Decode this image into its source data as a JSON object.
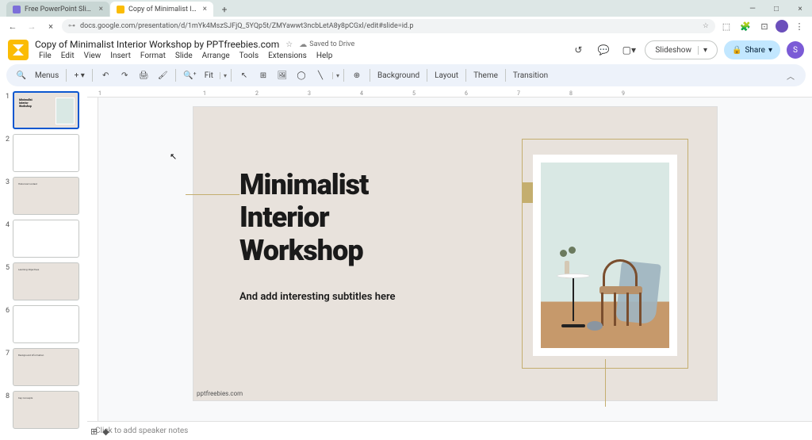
{
  "browser": {
    "tabs": [
      {
        "title": "Free PowerPoint Slide Downl",
        "active": false
      },
      {
        "title": "Copy of Minimalist Interior Wo",
        "active": true
      }
    ],
    "url": "docs.google.com/presentation/d/1mYk4MszSJFjQ_5YQp5t/ZMYawwt3ncbLetA8y8pCGxl/edit#slide=id.p"
  },
  "header": {
    "doc_title": "Copy of Minimalist Interior Workshop by PPTfreebies.com",
    "saved_status": "Saved to Drive",
    "menu": [
      "File",
      "Edit",
      "View",
      "Insert",
      "Format",
      "Slide",
      "Arrange",
      "Tools",
      "Extensions",
      "Help"
    ],
    "slideshow": "Slideshow",
    "share": "Share",
    "avatar_letter": "S"
  },
  "toolbar": {
    "menus": "Menus",
    "zoom": "Fit",
    "background": "Background",
    "layout": "Layout",
    "theme": "Theme",
    "transition": "Transition"
  },
  "filmstrip": {
    "slides": [
      {
        "n": "1",
        "kind": "title"
      },
      {
        "n": "2",
        "kind": "blank"
      },
      {
        "n": "3",
        "kind": "context",
        "label": "Historical Context"
      },
      {
        "n": "4",
        "kind": "blank"
      },
      {
        "n": "5",
        "kind": "objectives",
        "label": "Learning Objectives"
      },
      {
        "n": "6",
        "kind": "blank"
      },
      {
        "n": "7",
        "kind": "background",
        "label": "Background Information"
      },
      {
        "n": "8",
        "kind": "concepts",
        "label": "Key Concepts"
      }
    ]
  },
  "ruler": {
    "marks": [
      "1",
      "",
      "1",
      "2",
      "3",
      "4",
      "5",
      "6",
      "7",
      "8",
      "9"
    ]
  },
  "slide": {
    "title_l1": "Minimalist",
    "title_l2": "Interior",
    "title_l3": "Workshop",
    "subtitle": "And add interesting subtitles here",
    "footer": "pptfreebies.com"
  },
  "notes": {
    "placeholder": "Click to add speaker notes"
  }
}
